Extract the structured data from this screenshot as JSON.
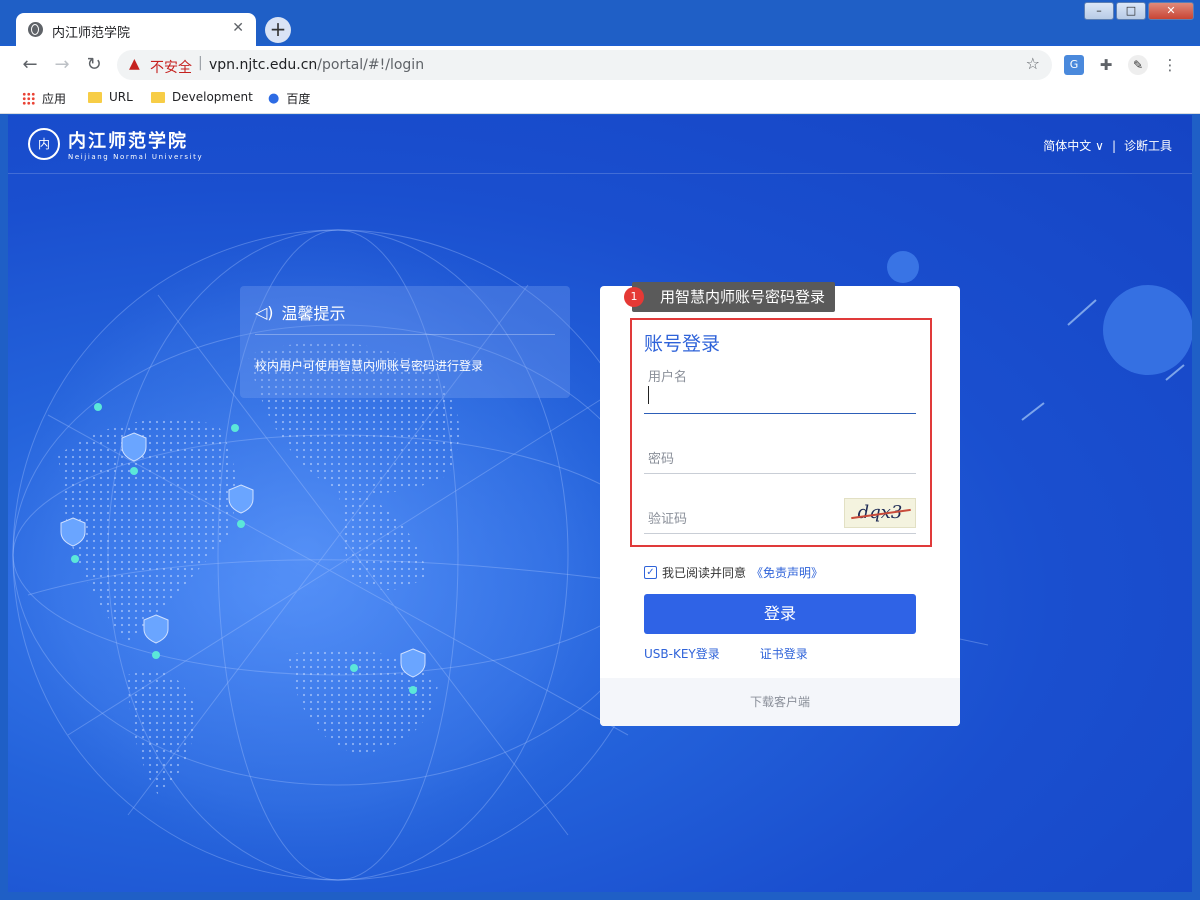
{
  "browser": {
    "tab_title": "内江师范学院",
    "tab_close": "✕",
    "new_tab": "+",
    "window_minimize": "–",
    "window_maximize": "□",
    "window_close": "✕",
    "nav_back": "←",
    "nav_forward": "→",
    "nav_reload": "↻",
    "security_warning_icon": "▲",
    "security_label": "不安全",
    "separator": "|",
    "url_domain": "vpn.njtc.edu.cn",
    "url_path": "/portal/#!/login",
    "star": "☆",
    "ext_translate": "G",
    "ext_puzzle": "✚",
    "ext_avatar": "✎",
    "menu": "⋮"
  },
  "bookmarks": [
    {
      "label": "应用",
      "icon": "apps-grid-icon"
    },
    {
      "label": "URL",
      "icon": "folder-icon"
    },
    {
      "label": "Development",
      "icon": "folder-icon"
    },
    {
      "label": "百度",
      "icon": "baidu-paw-icon"
    }
  ],
  "header": {
    "logo_seal": "内",
    "logo_name": "内江师范学院",
    "logo_sub": "Neijiang Normal University",
    "language": "简体中文",
    "lang_chevron": "∨",
    "divider": "|",
    "diagnose": "诊断工具"
  },
  "tips": {
    "icon": "◁)",
    "title": "温馨提示",
    "body": "校内用户可使用智慧内师账号密码进行登录"
  },
  "login": {
    "title": "账号登录",
    "username_label": "用户名",
    "password_label": "密码",
    "captcha_label": "验证码",
    "captcha_text": "dqx3",
    "agree_check": "✓",
    "agree_text": "我已阅读并同意",
    "disclaimer": "《免责声明》",
    "submit": "登录",
    "usb_key": "USB-KEY登录",
    "certificate": "证书登录",
    "download": "下载客户端"
  },
  "callout": {
    "badge": "1",
    "text": "用智慧内师账号密码登录"
  },
  "colors": {
    "accent": "#2f63e6",
    "highlight": "#e03a3a",
    "page_bg": "#1e5fcf"
  }
}
